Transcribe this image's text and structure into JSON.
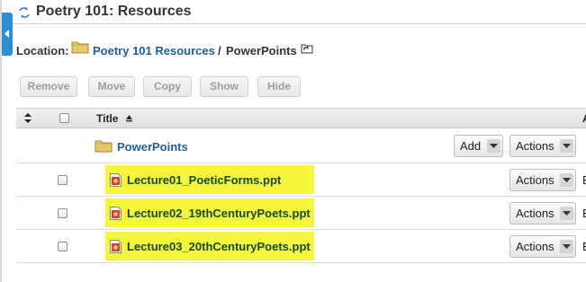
{
  "window": {
    "title": "Poetry 101: Resources"
  },
  "location": {
    "label": "Location:",
    "root_link": "Poetry 101 Resources",
    "separator": "/",
    "current": "PowerPoints"
  },
  "toolbar": {
    "remove": "Remove",
    "move": "Move",
    "copy": "Copy",
    "show": "Show",
    "hide": "Hide"
  },
  "table": {
    "headers": {
      "title": "Title",
      "cut_off": "A"
    },
    "folder_row": {
      "name": "PowerPoints",
      "add_label": "Add",
      "actions_label": "Actions"
    },
    "files": [
      {
        "name": "Lecture01_PoeticForms.ppt",
        "actions_label": "Actions",
        "cut_off": "E"
      },
      {
        "name": "Lecture02_19thCenturyPoets.ppt",
        "actions_label": "Actions",
        "cut_off": "E"
      },
      {
        "name": "Lecture03_20thCenturyPoets.ppt",
        "actions_label": "Actions",
        "cut_off": "E"
      }
    ]
  },
  "icons": {
    "title_icon": "refresh-arrows-icon",
    "folder": "folder-icon",
    "up_folder": "up-folder-icon",
    "ppt_file": "ppt-file-icon",
    "sidebar_toggle": "chevron-left-icon"
  },
  "colors": {
    "link": "#1f5fa8",
    "highlight": "#f5f53a",
    "file_text": "#154a18",
    "sidebar_tab": "#2d8ed6"
  }
}
